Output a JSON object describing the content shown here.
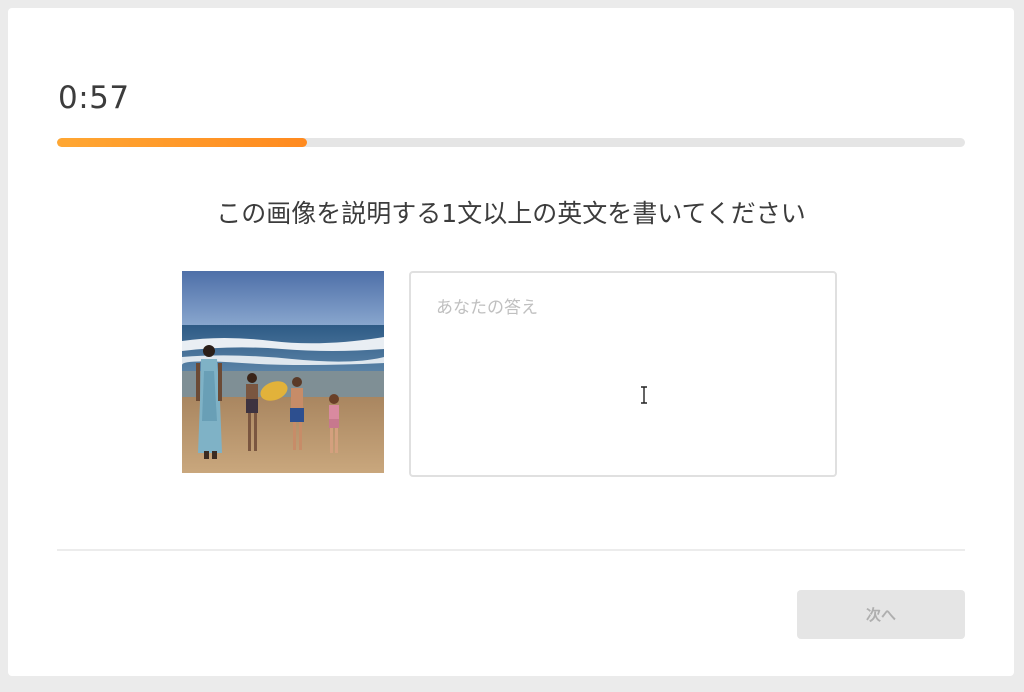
{
  "timer": {
    "text": "0:57"
  },
  "progress": {
    "fraction": 0.275,
    "colors": {
      "start": "#ffa733",
      "end": "#ff8a1f",
      "track": "#e5e5e5"
    }
  },
  "prompt": {
    "text": "この画像を説明する1文以上の英文を書いてください"
  },
  "answer": {
    "placeholder": "あなたの答え",
    "value": ""
  },
  "image": {
    "icon": "beach-photo"
  },
  "next_button": {
    "label": "次へ",
    "state": "disabled"
  },
  "icons": {
    "cursor": "text-cursor-icon"
  }
}
